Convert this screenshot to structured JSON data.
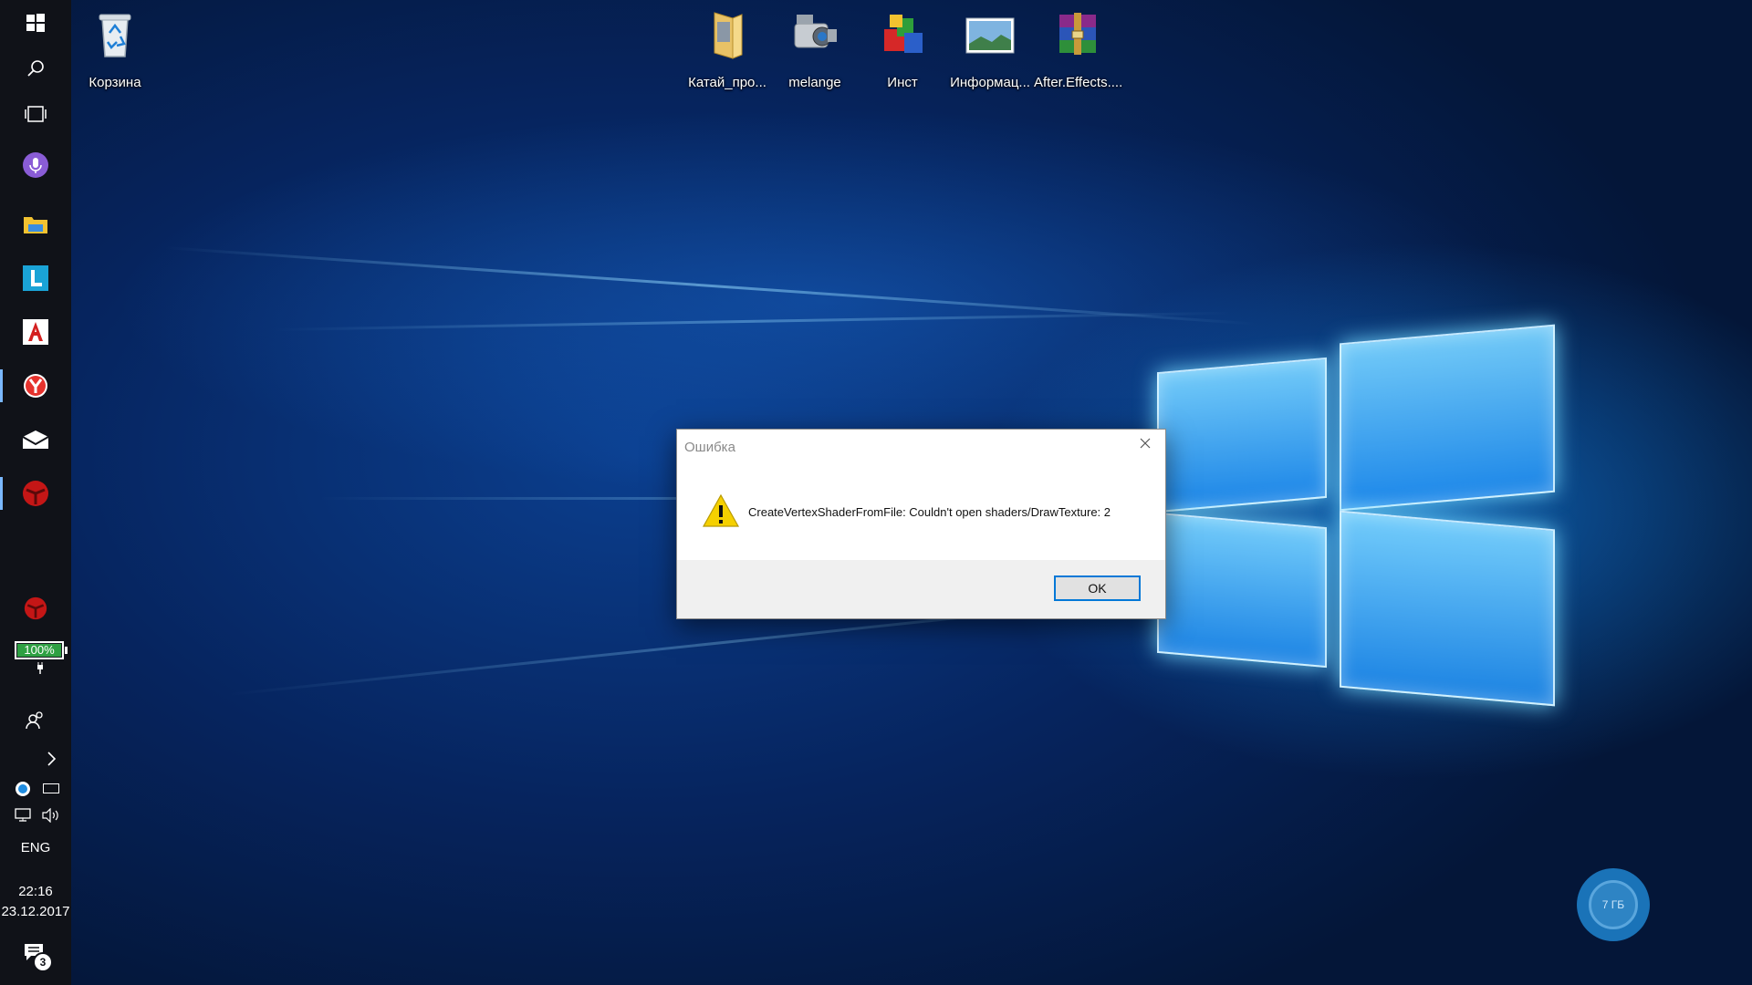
{
  "desktop": {
    "icons": [
      {
        "label": "Корзина",
        "icon": "recycle-bin-icon"
      },
      {
        "label": "Катай_про...",
        "icon": "folder-icon"
      },
      {
        "label": "melange",
        "icon": "video-camera-icon"
      },
      {
        "label": "Инст",
        "icon": "app-cubes-icon"
      },
      {
        "label": "Информац...",
        "icon": "image-file-icon"
      },
      {
        "label": "After.Effects....",
        "icon": "winrar-archive-icon"
      }
    ]
  },
  "taskbar": {
    "pinned": [
      {
        "icon": "windows-start-icon"
      },
      {
        "icon": "search-icon"
      },
      {
        "icon": "task-view-icon"
      },
      {
        "icon": "cortana-mic-icon"
      },
      {
        "icon": "file-explorer-icon"
      },
      {
        "icon": "l-app-icon"
      },
      {
        "icon": "autocad-icon"
      },
      {
        "icon": "yandex-browser-icon"
      },
      {
        "icon": "mail-icon"
      },
      {
        "icon": "red-app-icon"
      }
    ],
    "tray": {
      "battery_percent": "100%",
      "language": "ENG",
      "time": "22:16",
      "date": "23.12.2017",
      "notifications_count": "3"
    }
  },
  "dialog": {
    "title": "Ошибка",
    "message": "CreateVertexShaderFromFile: Couldn't open shaders/DrawTexture: 2",
    "ok_label": "OK"
  },
  "storage_badge": {
    "label": "7 ГБ"
  },
  "colors": {
    "accent": "#0078d7",
    "taskbar": "#101218",
    "battery_green": "#2ea043",
    "warning_yellow": "#f5d000"
  }
}
